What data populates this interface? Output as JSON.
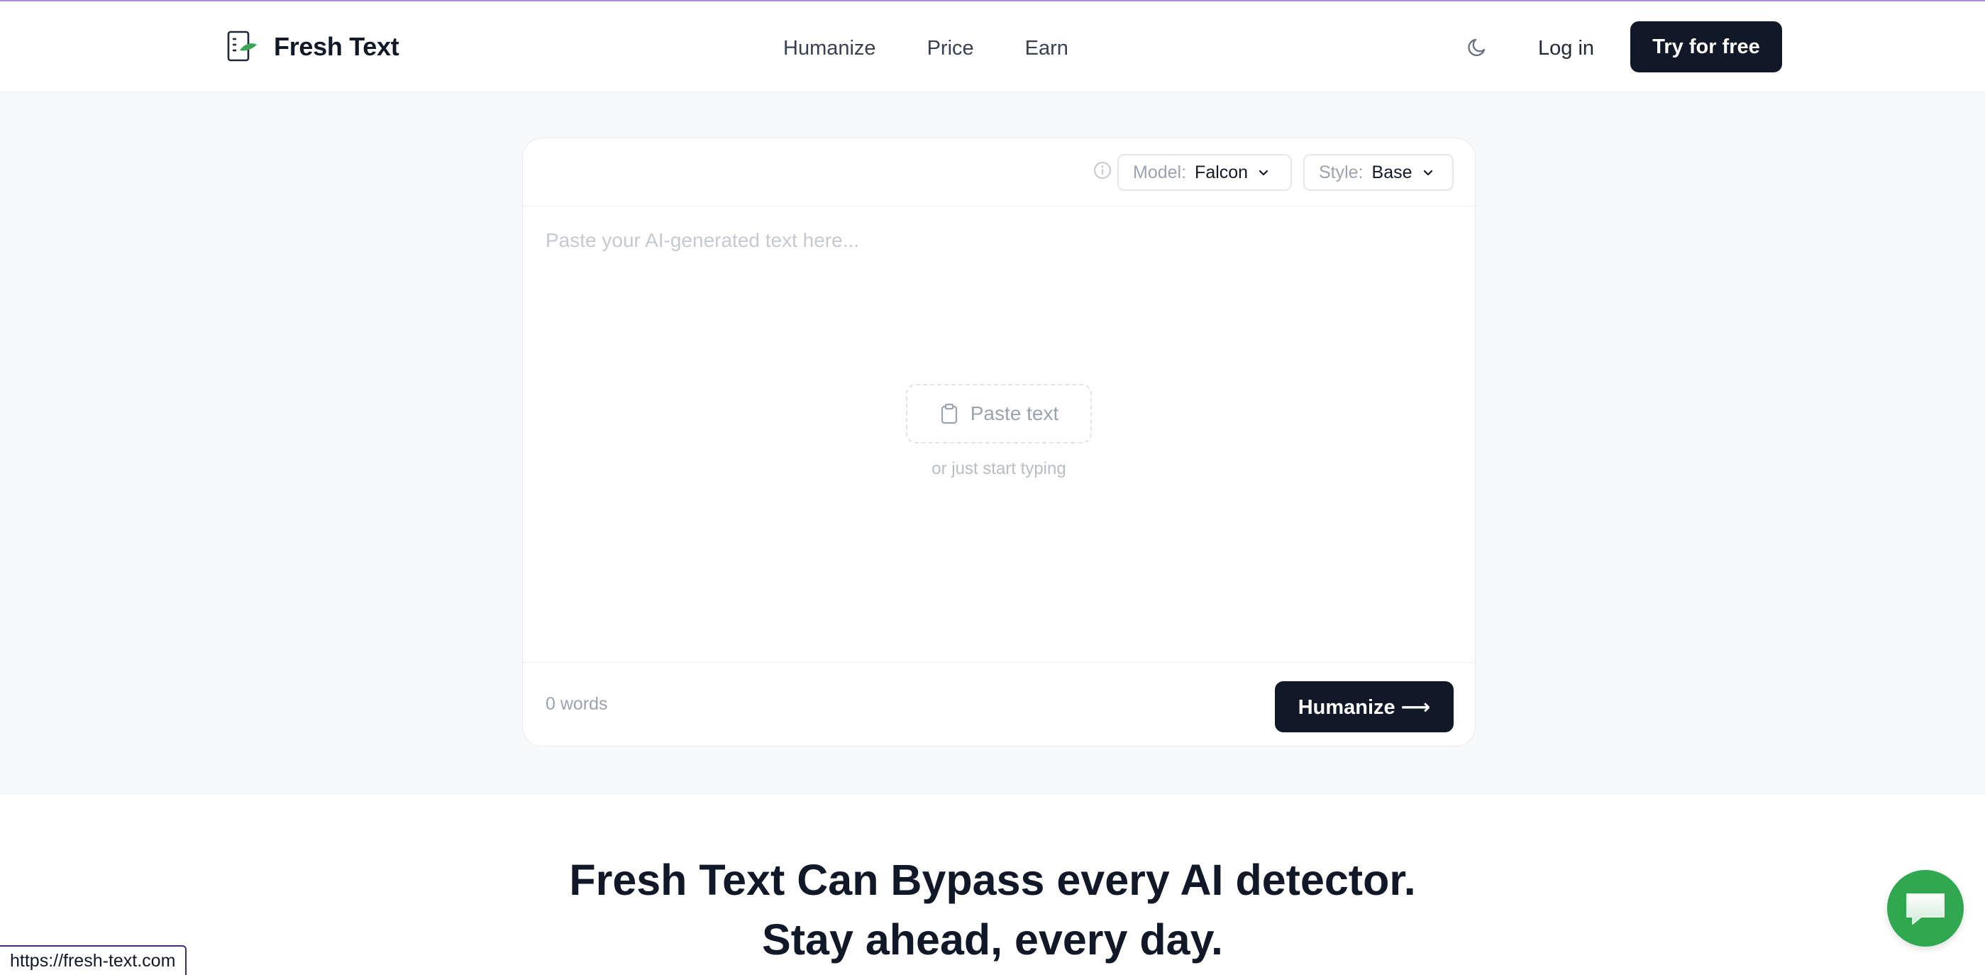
{
  "header": {
    "brand_name": "Fresh Text",
    "nav": [
      "Humanize",
      "Price",
      "Earn"
    ],
    "login_label": "Log in",
    "cta_label": "Try for free"
  },
  "editor": {
    "model_label": "Model:",
    "model_value": "Falcon",
    "style_label": "Style:",
    "style_value": "Base",
    "placeholder": "Paste your AI-generated text here...",
    "paste_label": "Paste text",
    "hint": "or just start typing",
    "word_count": "0 words",
    "submit_label": "Humanize ⟶"
  },
  "hero": {
    "line1": "Fresh Text Can Bypass every AI detector.",
    "line2": "Stay ahead, every day."
  },
  "status_url": "https://fresh-text.com",
  "colors": {
    "primary_dark": "#111827",
    "chat_green": "#2fa84f",
    "logo_leaf": "#3aa655"
  },
  "icons": [
    "logo-icon",
    "moon-icon",
    "info-icon",
    "chevron-down-icon",
    "clipboard-icon",
    "chat-icon"
  ]
}
